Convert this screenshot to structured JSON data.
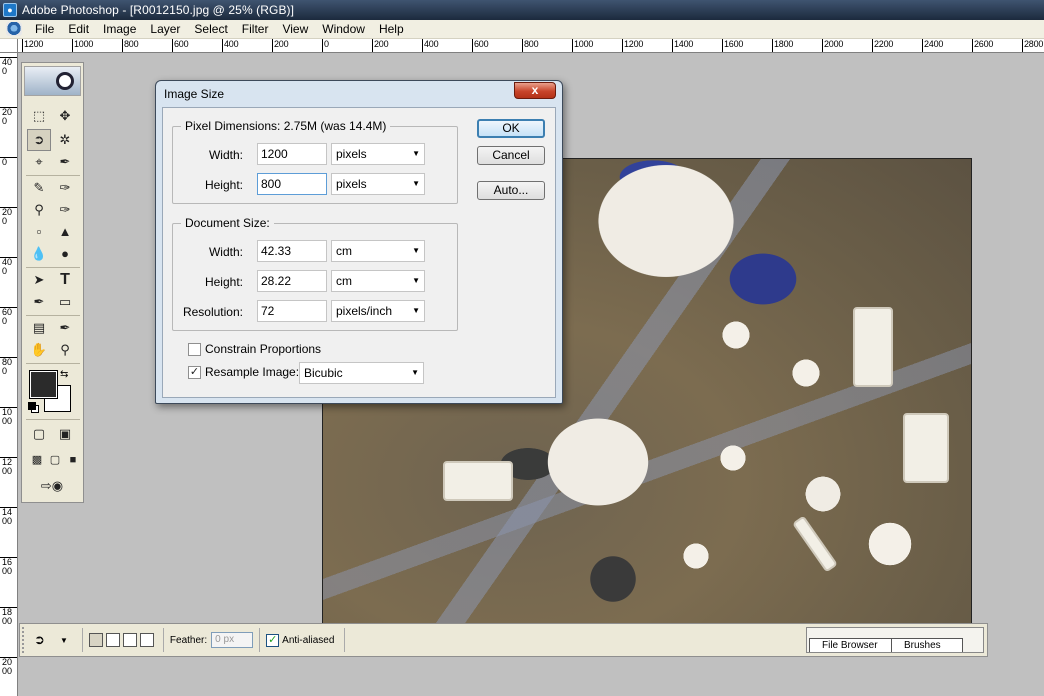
{
  "window": {
    "title": "Adobe Photoshop - [R0012150.jpg @ 25% (RGB)]"
  },
  "menu": [
    "File",
    "Edit",
    "Image",
    "Layer",
    "Select",
    "Filter",
    "View",
    "Window",
    "Help"
  ],
  "ruler": {
    "horizontal_labels": [
      "1200",
      "1000",
      "800",
      "600",
      "400",
      "200",
      "0",
      "200",
      "400",
      "600",
      "800",
      "1000",
      "1200",
      "1400",
      "1600",
      "1800",
      "2000",
      "2200",
      "2400",
      "2600",
      "2800"
    ],
    "vertical_labels": [
      "400",
      "200",
      "0",
      "200",
      "400",
      "600",
      "800",
      "1000",
      "1200",
      "1400",
      "1600",
      "1800",
      "2000"
    ]
  },
  "dialog": {
    "title": "Image Size",
    "close_label": "x",
    "pixel_dimensions": {
      "legend": "Pixel Dimensions:  2.75M (was 14.4M)",
      "width_label": "Width:",
      "width_value": "1200",
      "width_unit": "pixels",
      "height_label": "Height:",
      "height_value": "800",
      "height_unit": "pixels"
    },
    "document_size": {
      "legend": "Document Size:",
      "width_label": "Width:",
      "width_value": "42.33",
      "width_unit": "cm",
      "height_label": "Height:",
      "height_value": "28.22",
      "height_unit": "cm",
      "resolution_label": "Resolution:",
      "resolution_value": "72",
      "resolution_unit": "pixels/inch"
    },
    "constrain_label": "Constrain Proportions",
    "constrain_checked": false,
    "resample_label": "Resample Image:",
    "resample_checked": true,
    "resample_method": "Bicubic",
    "buttons": {
      "ok": "OK",
      "cancel": "Cancel",
      "auto": "Auto..."
    }
  },
  "options": {
    "feather_label": "Feather:",
    "feather_value": "0 px",
    "antialias_label": "Anti-aliased",
    "antialias_checked": true
  },
  "palette_tabs": [
    "File Browser",
    "Brushes"
  ]
}
